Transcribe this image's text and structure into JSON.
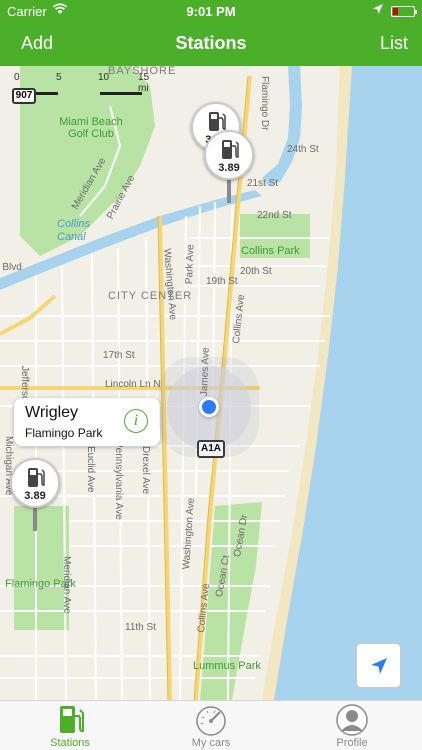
{
  "status_bar": {
    "carrier": "Carrier",
    "time": "9:01 PM",
    "battery_color": "#d0021b"
  },
  "nav": {
    "left_button": "Add",
    "title": "Stations",
    "right_button": "List",
    "background": "#4caf2a"
  },
  "map": {
    "scale": {
      "ticks": [
        "0",
        "5",
        "10",
        "15 mi"
      ]
    },
    "labels": {
      "bayshore": "BAYSHORE",
      "golf_club": "Miami Beach Golf Club",
      "collins_canal": "Collins Canal",
      "collins_park": "Collins Park",
      "city_center": "CITY CENTER",
      "flamingo_park": "Flamingo Park",
      "lummus_park": "Lummus Park",
      "meridian_ave": "Meridian Ave",
      "prairie_ave": "Prairie Ave",
      "washington_ave": "Washington Ave",
      "washington_ave_2": "Washington Ave",
      "collins_ave": "Collins Ave",
      "collins_ave_2": "Collins Ave",
      "park_ave": "Park Ave",
      "james_ave": "James Ave",
      "jefferson_ave": "Jefferson Ave",
      "meridian_ave_2": "Meridian Ave",
      "euclid_ave": "Euclid Ave",
      "pennsylvania_ave": "Pennsylvania Ave",
      "drexel_ave": "Drexel Ave",
      "michigan_ave": "Michigan Ave",
      "ocean_ct": "Ocean Ct",
      "ocean_dr": "Ocean Dr",
      "flamingo_dr": "Flamingo Dr",
      "st_24": "24th St",
      "st_22": "22nd St",
      "st_21": "21st St",
      "st_20": "20th St",
      "st_19": "19th St",
      "st_17": "17th St",
      "lincoln_ln": "Lincoln Ln N",
      "st_11": "11th St",
      "blvd": "e Blvd"
    },
    "shields": {
      "route_907": "907",
      "route_a1a": "A1A"
    },
    "pins": [
      {
        "price": "3.89"
      },
      {
        "price": "3.89"
      },
      {
        "price": "3.89"
      }
    ],
    "callout": {
      "name": "Wrigley",
      "subtitle": "Flamingo Park",
      "info_glyph": "i"
    }
  },
  "tabs": [
    {
      "label": "Stations",
      "icon": "gas-pump-icon",
      "active": true
    },
    {
      "label": "My cars",
      "icon": "speedometer-icon",
      "active": false
    },
    {
      "label": "Profile",
      "icon": "person-icon",
      "active": false
    }
  ],
  "colors": {
    "accent": "#4caf2a",
    "water": "#a8d3ef",
    "park": "#b8e3a5",
    "user_location": "#2b7cf6"
  }
}
